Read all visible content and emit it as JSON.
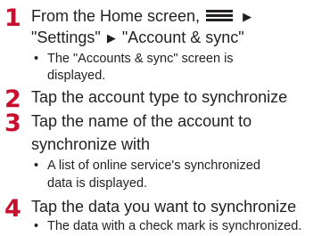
{
  "steps": [
    {
      "number": "1",
      "line1_prefix": "From the Home screen,",
      "arrow": "▶",
      "line2_part1": "\"Settings\"",
      "line2_part2": "\"Account & sync\"",
      "note_line1": "The \"Accounts & sync\" screen is",
      "note_line2": "displayed."
    },
    {
      "number": "2",
      "line1": "Tap the account type to synchronize"
    },
    {
      "number": "3",
      "line1": "Tap the name of the account to",
      "line2": "synchronize with",
      "note_line1": "A list of online service's synchronized",
      "note_line2": "data is displayed."
    },
    {
      "number": "4",
      "line1": "Tap the data you want to synchronize",
      "note_line1": "The data with a check mark is synchronized."
    }
  ],
  "bullet": "•",
  "icons": {
    "menu": "menu-icon"
  },
  "colors": {
    "step_number": "#c8102e",
    "text": "#231f20"
  }
}
